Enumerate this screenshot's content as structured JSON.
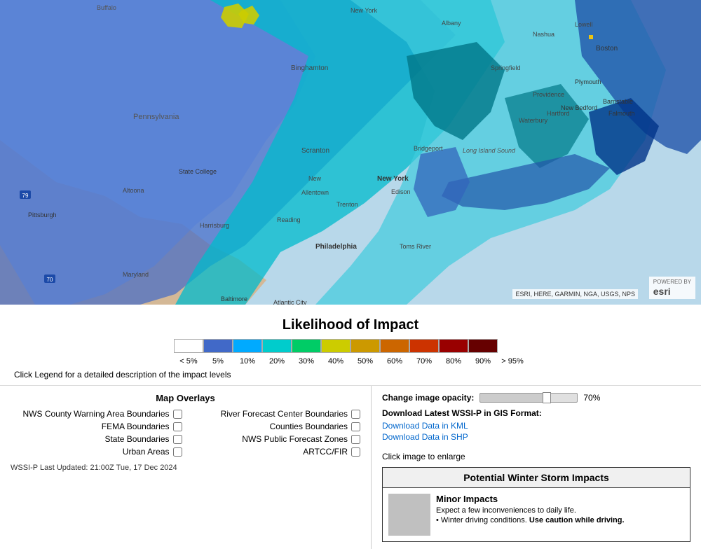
{
  "map": {
    "attribution": "ESRI, HERE, GARMIN, NGA, USGS, NPS",
    "powered_by": "POWERED BY",
    "esri_label": "esri"
  },
  "legend": {
    "title": "Likelihood of Impact",
    "colors": [
      "#ffffff",
      "#4169c8",
      "#00aaff",
      "#00cccc",
      "#00cc66",
      "#cccc00",
      "#cc9900",
      "#cc6600",
      "#cc3300",
      "#990000",
      "#660000"
    ],
    "labels": [
      "< 5%",
      "5%",
      "10%",
      "20%",
      "30%",
      "40%",
      "50%",
      "60%",
      "70%",
      "80%",
      "90%",
      "95%"
    ],
    "label_widths": [
      40,
      35,
      35,
      35,
      35,
      40,
      35,
      35,
      35,
      35,
      35,
      42
    ],
    "click_note": "Click Legend for a detailed description of the impact levels"
  },
  "overlays": {
    "title": "Map Overlays",
    "items_left": [
      {
        "label": "NWS County Warning Area Boundaries",
        "checked": false
      },
      {
        "label": "FEMA Boundaries",
        "checked": false
      },
      {
        "label": "State Boundaries",
        "checked": false
      },
      {
        "label": "Urban Areas",
        "checked": false
      }
    ],
    "items_right": [
      {
        "label": "River Forecast Center Boundaries",
        "checked": false
      },
      {
        "label": "Counties Boundaries",
        "checked": false
      },
      {
        "label": "NWS Public Forecast Zones",
        "checked": false
      },
      {
        "label": "ARTCC/FIR",
        "checked": false
      }
    ]
  },
  "wssi_updated": "WSSI-P Last Updated: 21:00Z Tue, 17 Dec 2024",
  "controls": {
    "opacity_label": "Change image opacity:",
    "opacity_value": "70%",
    "download_title": "Download Latest WSSI-P in GIS Format:",
    "download_kml": "Download Data in KML",
    "download_shp": "Download Data in SHP",
    "click_enlarge": "Click image to enlarge"
  },
  "impact_card": {
    "title": "Potential Winter Storm Impacts",
    "minor_title": "Minor Impacts",
    "minor_subtitle": "Expect a few inconveniences to daily life.",
    "bullet1": "• Winter driving conditions.",
    "bullet1_bold": " Use caution while driving."
  }
}
